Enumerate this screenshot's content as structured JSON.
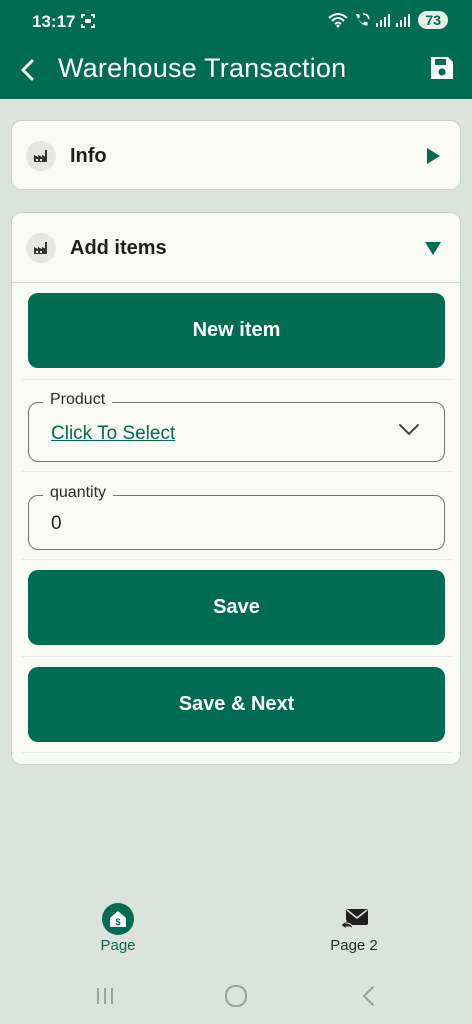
{
  "status_bar": {
    "time": "13:17",
    "battery": "73",
    "icons": [
      "screen-record-icon",
      "wifi-icon",
      "wifi-call-icon",
      "signal-icon",
      "signal-icon"
    ]
  },
  "app_bar": {
    "title": "Warehouse Transaction",
    "back_icon": "chevron-left-icon",
    "save_icon": "floppy-disk-icon"
  },
  "sections": {
    "info": {
      "label": "Info",
      "icon": "factory-icon",
      "state": "collapsed"
    },
    "add_items": {
      "label": "Add items",
      "icon": "factory-icon",
      "state": "expanded"
    }
  },
  "form": {
    "new_item_label": "New item",
    "product": {
      "legend": "Product",
      "value": "Click To Select"
    },
    "quantity": {
      "legend": "quantity",
      "value": "0"
    },
    "save_label": "Save",
    "save_next_label": "Save & Next"
  },
  "bottom_nav": {
    "items": [
      {
        "label": "Page",
        "icon": "house-dollar-icon",
        "active": true
      },
      {
        "label": "Page 2",
        "icon": "mail-reply-icon",
        "active": false
      }
    ]
  },
  "system_nav": [
    "recents-button",
    "home-button",
    "back-button"
  ],
  "colors": {
    "primary": "#006c52",
    "background": "#dce3dc",
    "card": "#f9faf6"
  }
}
